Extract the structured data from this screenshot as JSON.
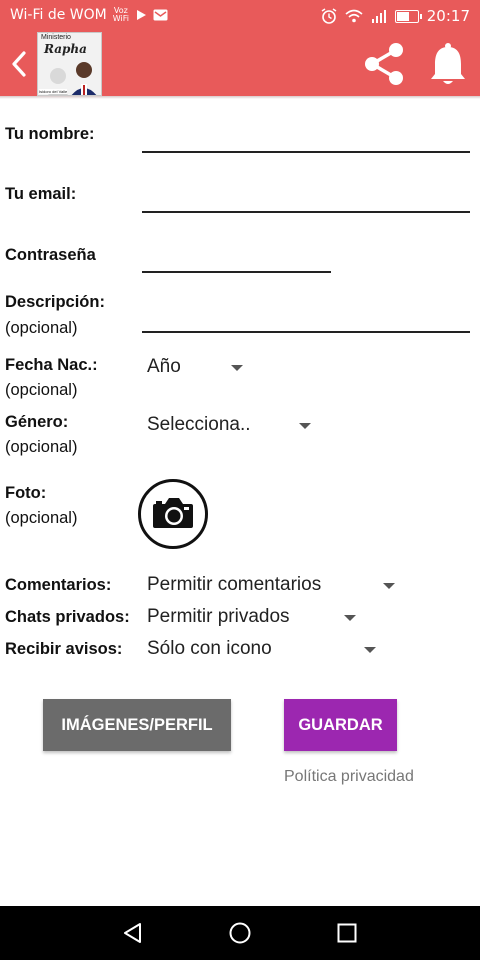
{
  "status_bar": {
    "carrier": "Wi-Fi de WOM",
    "voz": "Voz",
    "wifi": "WiFi",
    "time": "20:17",
    "battery_level": 0.55,
    "icons": [
      "play-icon",
      "mail-icon",
      "alarm-icon",
      "wifi-icon",
      "signal-icon",
      "battery-icon"
    ]
  },
  "app_bar": {
    "color": "#e85a5a",
    "logo": {
      "line1": "Ministerio",
      "line2": "Rapha",
      "caption": "Isidoro del Valle"
    },
    "icons": [
      "back-icon",
      "share-icon",
      "bell-icon"
    ]
  },
  "form": {
    "name_label": "Tu nombre:",
    "email_label": "Tu email:",
    "password_label": "Contraseña",
    "description_label": "Descripción:",
    "description_optional": "(opcional)",
    "birth_label": "Fecha Nac.:",
    "birth_optional": "(opcional)",
    "birth_value": "Año",
    "gender_label": "Género:",
    "gender_optional": "(opcional)",
    "gender_value": "Selecciona..",
    "photo_label": "Foto:",
    "photo_optional": "(opcional)",
    "comments_label": "Comentarios:",
    "comments_value": "Permitir comentarios",
    "chats_label": "Chats privados:",
    "chats_value": "Permitir privados",
    "notify_label": "Recibir avisos:",
    "notify_value": "Sólo con icono"
  },
  "buttons": {
    "images_profile": "IMÁGENES/PERFIL",
    "save": "GUARDAR",
    "privacy": "Política privacidad",
    "grey_color": "#6b6b6b",
    "purple_color": "#9c27b0"
  },
  "nav": {
    "icons": [
      "back-triangle-icon",
      "home-circle-icon",
      "recents-square-icon"
    ]
  }
}
